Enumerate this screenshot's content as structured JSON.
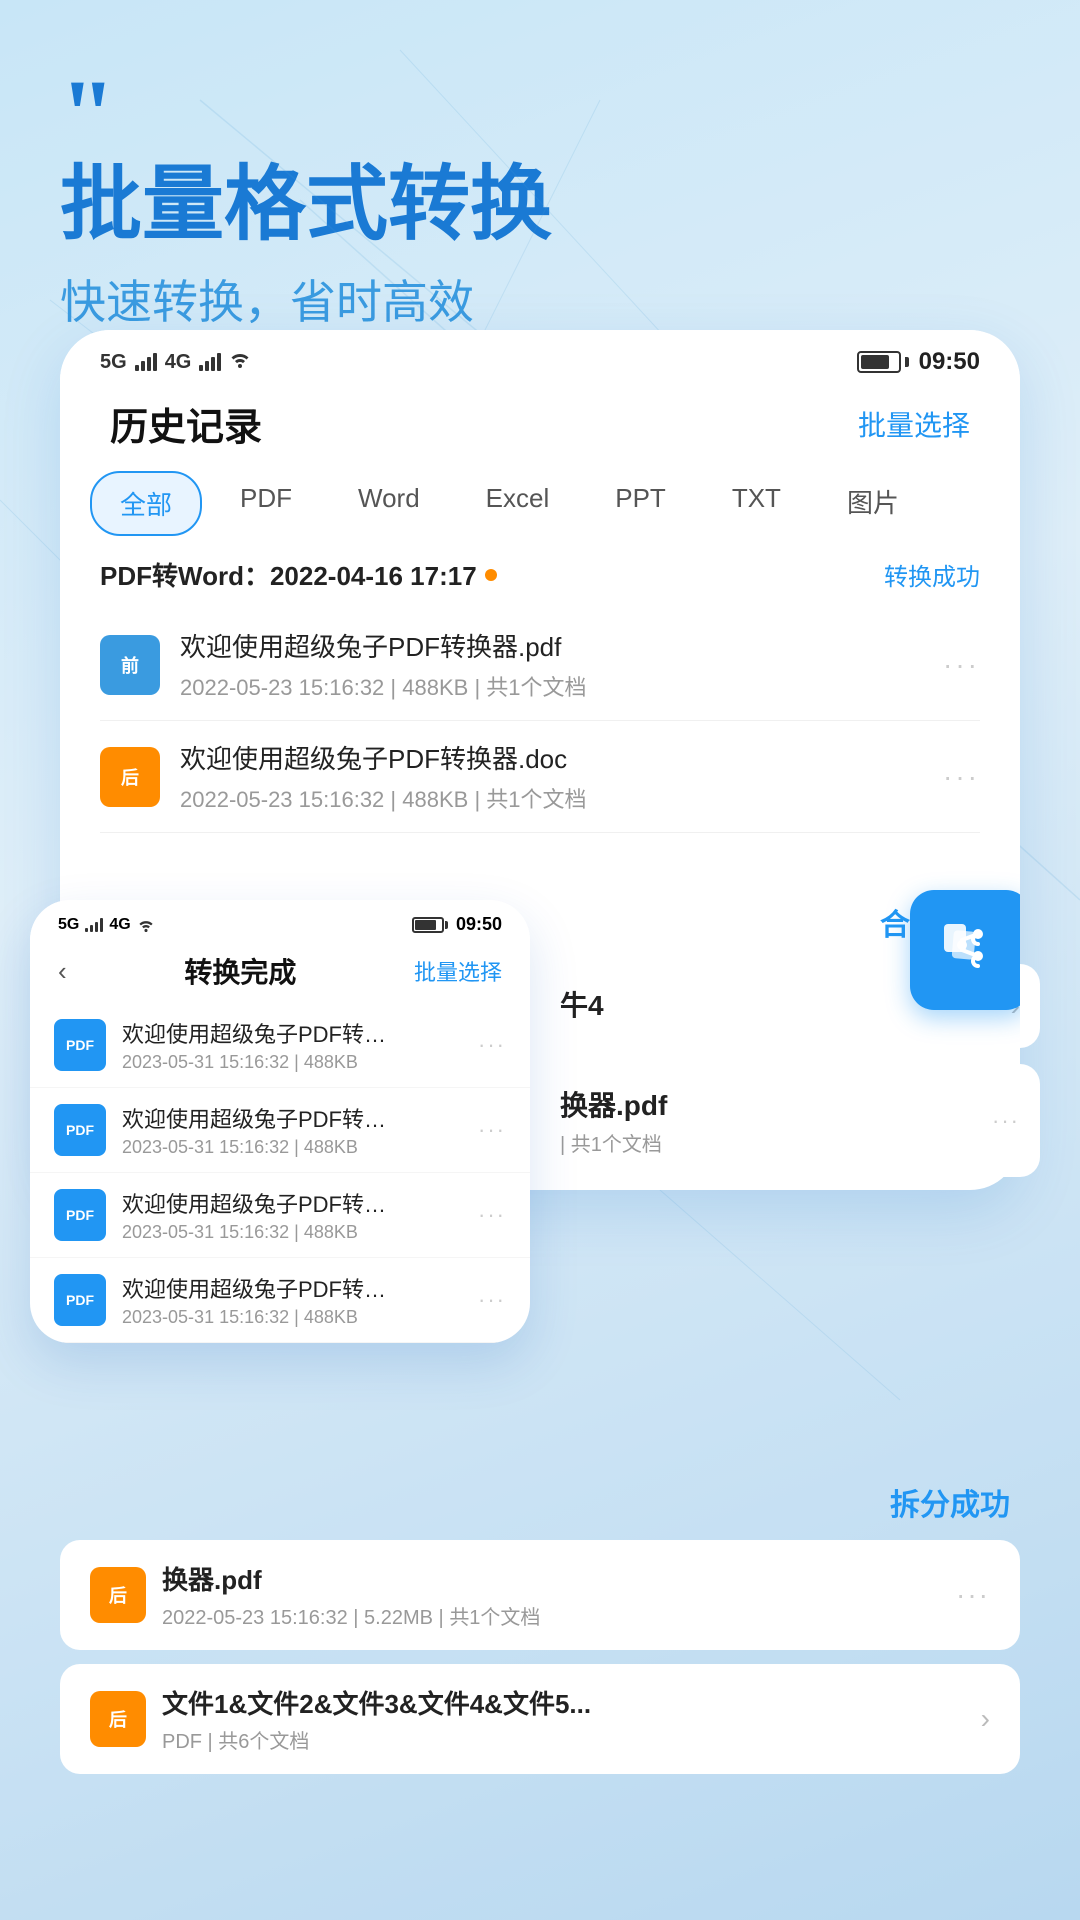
{
  "header": {
    "quote_mark": "❝",
    "title": "批量格式转换",
    "subtitle": "快速转换，省时高效"
  },
  "status_bar": {
    "signals": "5G 4G",
    "wifi": "WiFi",
    "battery_level": 80,
    "time": "09:50"
  },
  "main_screen": {
    "title": "历史记录",
    "batch_select": "批量选择",
    "tabs": [
      {
        "id": "all",
        "label": "全部",
        "active": true
      },
      {
        "id": "pdf",
        "label": "PDF",
        "active": false
      },
      {
        "id": "word",
        "label": "Word",
        "active": false
      },
      {
        "id": "excel",
        "label": "Excel",
        "active": false
      },
      {
        "id": "ppt",
        "label": "PPT",
        "active": false
      },
      {
        "id": "txt",
        "label": "TXT",
        "active": false
      },
      {
        "id": "image",
        "label": "图片",
        "active": false
      }
    ],
    "conv_group": {
      "title": "PDF转Word：2022-04-16 17:17",
      "status": "转换成功",
      "files": [
        {
          "badge": "前",
          "badge_type": "prev",
          "name": "欢迎使用超级兔子PDF转换器.pdf",
          "date": "2022-05-23 15:16:32",
          "size": "488KB",
          "docs": "共1个文档"
        },
        {
          "badge": "后",
          "badge_type": "after",
          "name": "欢迎使用超级兔子PDF转换器.doc",
          "date": "2022-05-23 15:16:32",
          "size": "488KB",
          "docs": "共1个文档"
        }
      ]
    }
  },
  "secondary_screen": {
    "title": "转换完成",
    "batch_select": "批量选择",
    "files": [
      {
        "name": "欢迎使用超级兔子PDF转换器.pdf",
        "date": "2023-05-31 15:16:32",
        "size": "488KB"
      },
      {
        "name": "欢迎使用超级兔子PDF转换器.pdf",
        "date": "2023-05-31 15:16:32",
        "size": "488KB"
      },
      {
        "name": "欢迎使用超级兔子PDF转换器.pdf",
        "date": "2023-05-31 15:16:32",
        "size": "488KB"
      },
      {
        "name": "欢迎使用超级兔子PDF转换器.pdf",
        "date": "2023-05-31 15:16:32",
        "size": "488KB"
      }
    ]
  },
  "right_panel": {
    "merge_status": "合并成功",
    "item1": {
      "name": "牛4",
      "arrow": "›"
    },
    "item2": {
      "name": "换器.pdf",
      "meta": "| 共1个文档"
    }
  },
  "bottom_panel": {
    "split_status": "拆分成功",
    "split_file": {
      "badge": "后",
      "name": "换器.pdf",
      "date": "2022-05-23 15:16:32",
      "size": "5.22MB",
      "docs": "共1个文档"
    },
    "combined_file": {
      "badge": "后",
      "name": "文件1&文件2&文件3&文件4&文件5...",
      "meta": "PDF  |  共6个文档",
      "arrow": "›"
    }
  },
  "share_icon": "⬡"
}
